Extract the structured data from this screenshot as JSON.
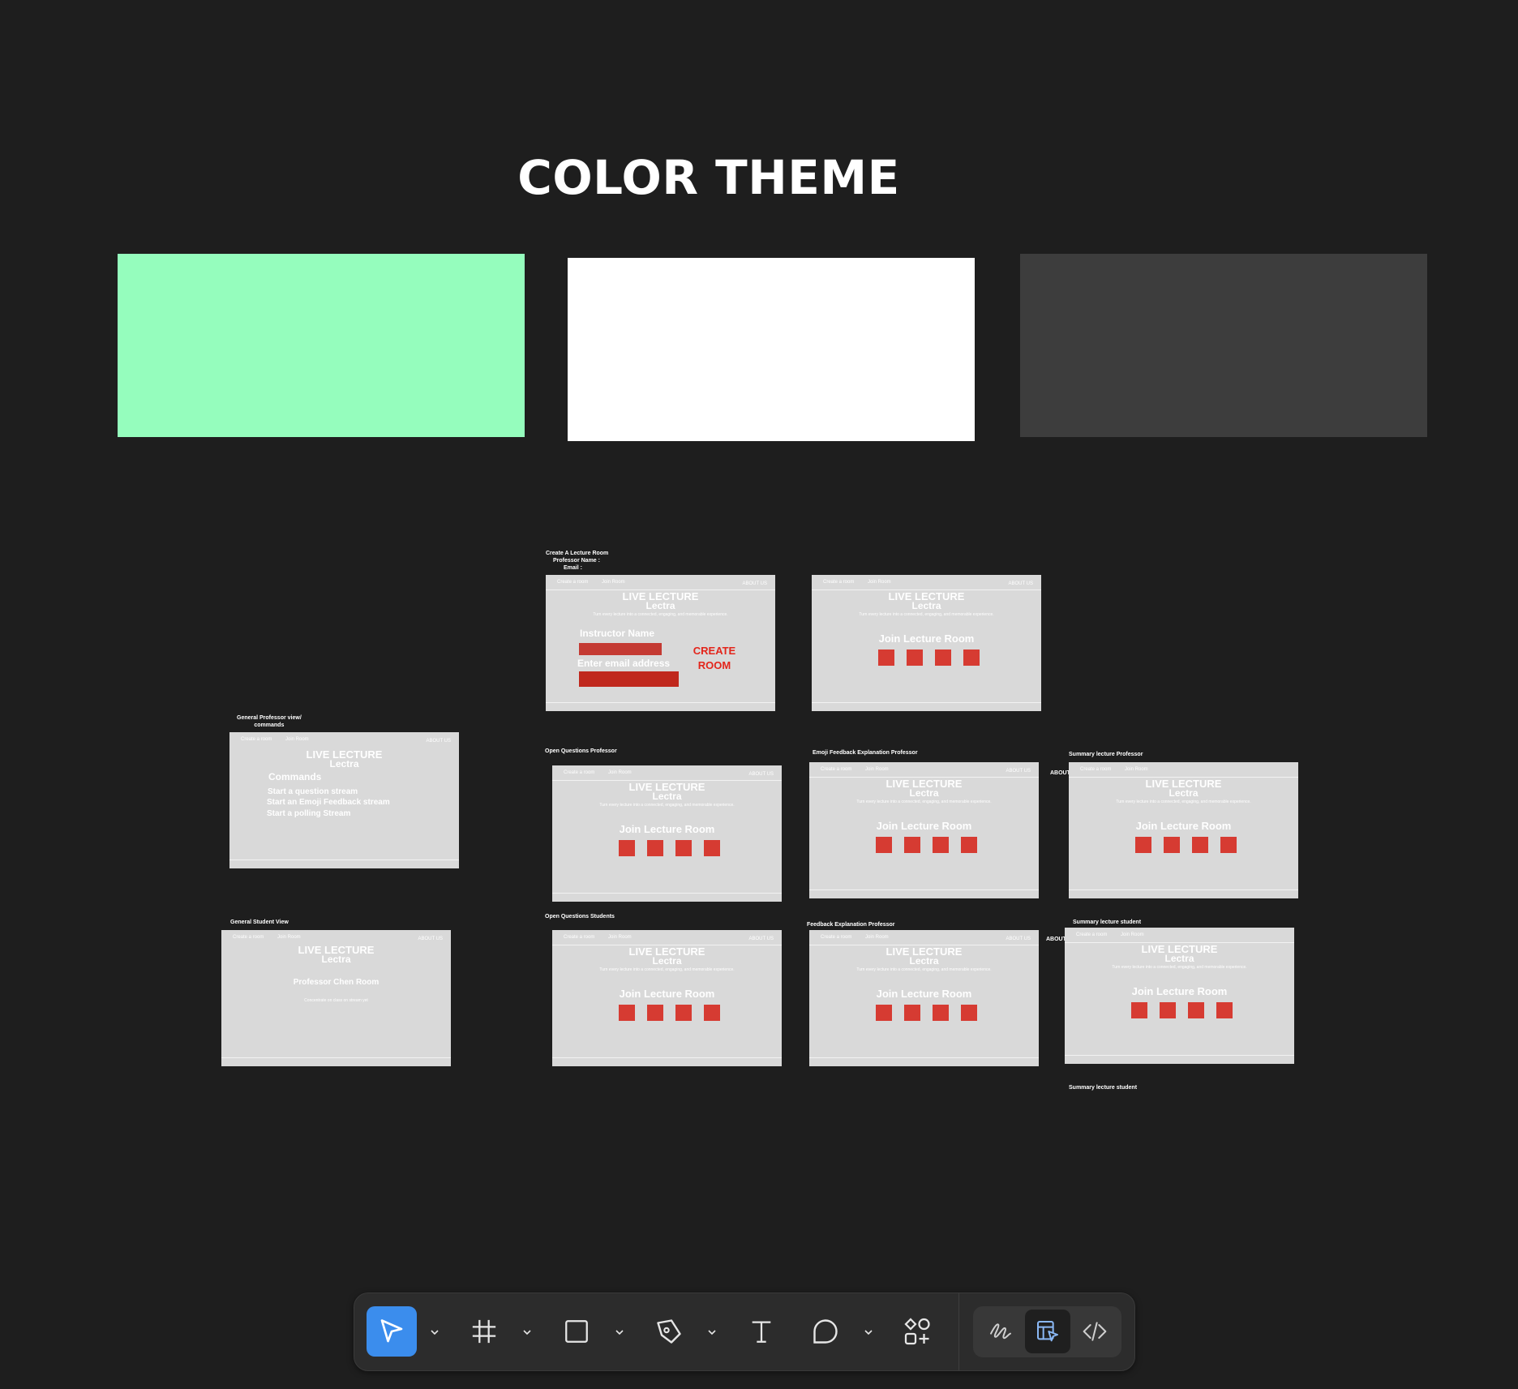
{
  "canvas": {
    "title": "COLOR THEME",
    "swatches": [
      {
        "name": "mint",
        "color": "#95fdbd"
      },
      {
        "name": "white",
        "color": "#ffffff"
      },
      {
        "name": "dark-gray",
        "color": "#3d3d3d"
      }
    ]
  },
  "labels": {
    "create_room": [
      "Create A Lecture Room",
      "Professor Name :",
      "Email :"
    ],
    "general_prof": [
      "General Professor  view/",
      "commands"
    ],
    "general_student": "General Student View",
    "open_q_prof": "Open Questions Professor",
    "open_q_students": "Open Questions Students",
    "emoji_prof": "Emoji Feedback Explanation Professor",
    "feedback_prof": "Feedback Explanation Professor",
    "summary_prof": "Summary lecture Professor",
    "summary_student_1": "Summary lecture student",
    "summary_student_2": "Summary lecture student",
    "about_us_stray": "ABOUT US"
  },
  "frame": {
    "nav_create": "Create a room",
    "nav_join": "Join Room",
    "nav_about": "ABOUT US",
    "heading": "LIVE LECTURE",
    "brand": "Lectra",
    "tagline": "Turn every lecture into a connected, engaging, and memorable experience.",
    "join_title": "Join Lecture Room"
  },
  "create_frame": {
    "instructor_label": "Instructor Name",
    "email_placeholder": "Enter email address",
    "create_button": [
      "CREATE",
      "ROOM"
    ]
  },
  "prof_frame": {
    "commands_title": "Commands",
    "commands": [
      "Start a question stream",
      "Start an Emoji Feedback stream",
      "Start a polling Stream"
    ]
  },
  "student_frame": {
    "room_title": "Professor Chen Room",
    "room_sub": "Concentrate on class on stream yet"
  },
  "toolbar": {
    "accent": "#3b8ded",
    "tools": [
      "move-tool",
      "frame-tool",
      "rectangle-tool",
      "pen-tool",
      "text-tool",
      "comment-tool",
      "assets-tool"
    ],
    "modes": [
      "draw-mode",
      "design-mode",
      "dev-mode"
    ]
  }
}
